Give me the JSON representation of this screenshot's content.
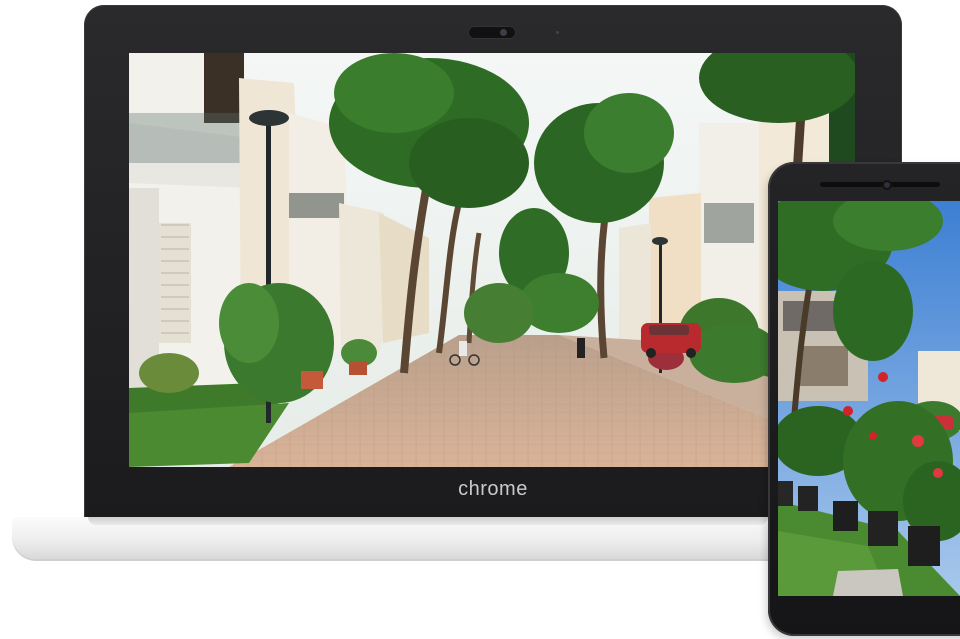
{
  "laptop": {
    "brand_label": "chrome",
    "screen_image": "residential-street-with-trees-and-villas"
  },
  "phone": {
    "screen_image": "potted-flowers-and-trees-beside-house"
  },
  "colors": {
    "sky": "#eef3f2",
    "sky_blue": "#4f8fd9",
    "foliage": "#2f6a2a",
    "foliage_light": "#6c9d3a",
    "pavement": "#caa58a",
    "wall": "#f1efe9",
    "bezel": "#1d1d1f",
    "laptop_base": "#f2f2f2"
  }
}
